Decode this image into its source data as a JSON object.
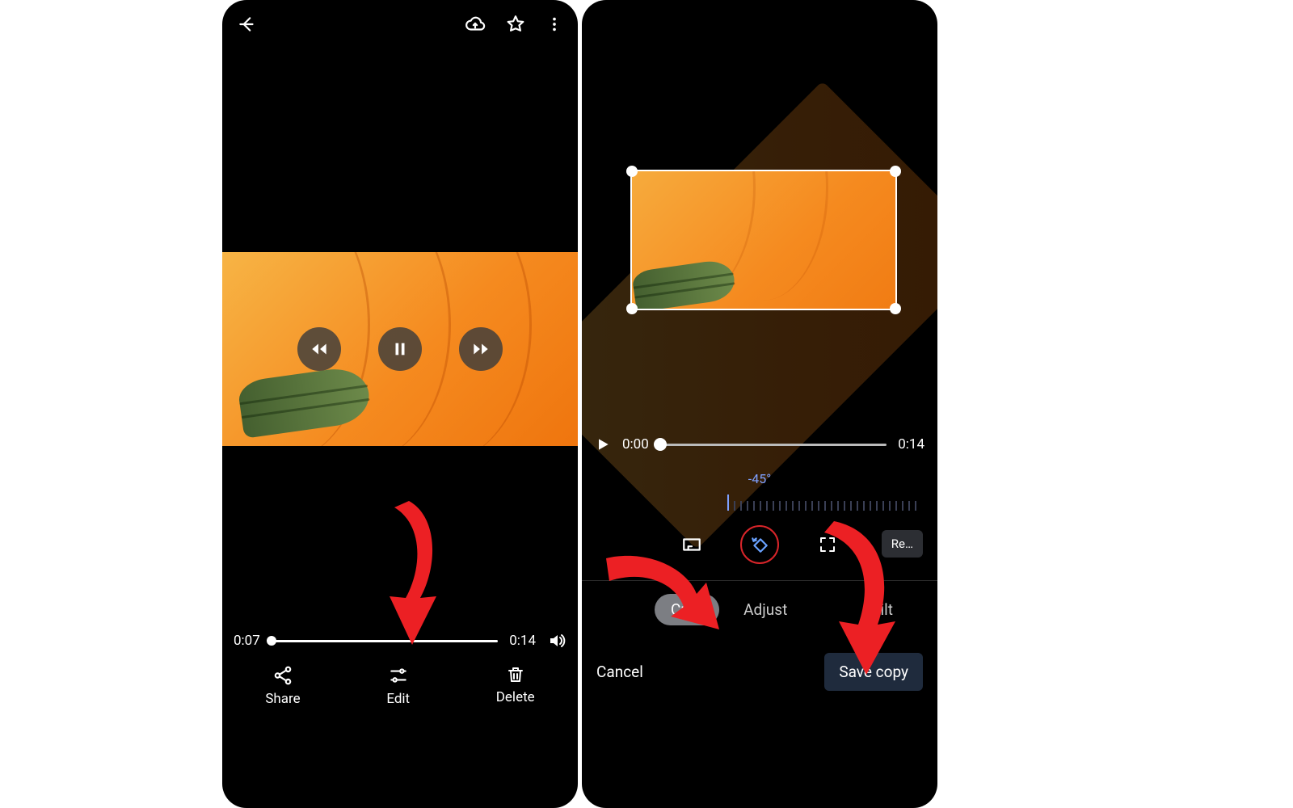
{
  "left": {
    "playback": {
      "current_time": "0:07",
      "duration": "0:14",
      "position_pct": 0
    },
    "bottom_actions": {
      "share": "Share",
      "edit": "Edit",
      "delete": "Delete"
    }
  },
  "right": {
    "playback": {
      "current_time": "0:00",
      "duration": "0:14",
      "position_pct": 0
    },
    "angle_label": "-45°",
    "reset_label": "Re…",
    "tabs": {
      "crop": "Crop",
      "adjust": "Adjust",
      "filter_truncated": "Filt"
    },
    "footer": {
      "cancel": "Cancel",
      "save": "Save copy"
    }
  }
}
